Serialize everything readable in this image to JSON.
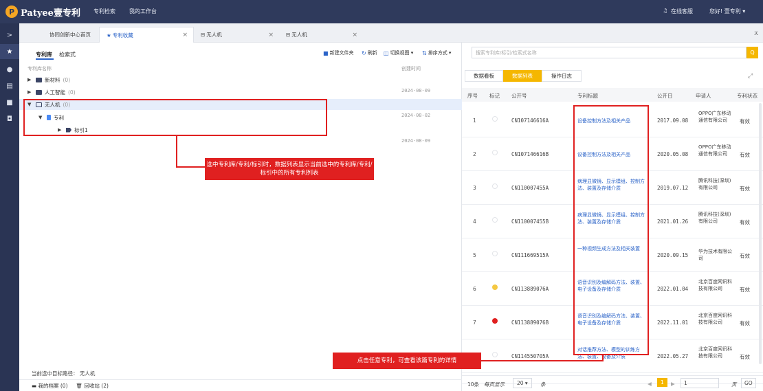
{
  "topbar": {
    "logo_mark": "P",
    "logo_text": "Patyee壹专利",
    "nav": [
      "专利检索",
      "我的工作台"
    ],
    "service": "在线客服",
    "greeting": "您好! 壹专利 ▾",
    "collapse": "ㅈ"
  },
  "rail": {
    "toggle": ">",
    "icons": [
      "star-icon",
      "folder-icon",
      "monitor-icon",
      "book-icon",
      "user-icon"
    ]
  },
  "tabs": [
    {
      "label": "协同创新中心首页",
      "active": false,
      "closable": false
    },
    {
      "label": "专利收藏",
      "active": true,
      "closable": true,
      "prefix": "★"
    },
    {
      "label": "无人机",
      "active": false,
      "closable": true,
      "prefix": "⊟"
    },
    {
      "label": "无人机",
      "active": false,
      "closable": true,
      "prefix": "⊟"
    }
  ],
  "left": {
    "subtabs": [
      "专利库",
      "检索式"
    ],
    "toolbar": [
      {
        "icon": "■",
        "label": "新建文件夹"
      },
      {
        "icon": "↻",
        "label": "刷新"
      },
      {
        "icon": "◫",
        "label": "切换视图 ▾"
      },
      {
        "icon": "⇅",
        "label": "排序方式 ▾"
      }
    ],
    "header": {
      "name": "专利库名称",
      "created": "创建时间"
    },
    "tree": [
      {
        "name": "新材料",
        "count": "(0)",
        "date": "2024-08-09",
        "level": 0,
        "expanded": false
      },
      {
        "name": "人工智能",
        "count": "(0)",
        "date": "2024-08-09",
        "level": 0,
        "expanded": false
      },
      {
        "name": "无人机",
        "count": "(0)",
        "date": "2024-08-02",
        "level": 0,
        "expanded": true
      },
      {
        "name": "专利",
        "count": "",
        "date": "",
        "level": 1,
        "expanded": true
      },
      {
        "name": "标引1",
        "count": "",
        "date": "2024-08-09",
        "level": 2,
        "expanded": false
      }
    ],
    "path_label": "当前选中目标路径：",
    "path_value": "无人机",
    "footer": [
      {
        "icon": "▬",
        "label": "我的档案 (0)"
      },
      {
        "icon": "🗑",
        "label": "回收站 (2)"
      }
    ]
  },
  "right": {
    "search_placeholder": "搜索专利库/标引/检索式名称",
    "search_icon": "Q",
    "view_tabs": [
      "数据看板",
      "数据列表",
      "操作日志"
    ],
    "active_view": 1,
    "expand_icon": "⤢",
    "columns": [
      "序号",
      "标记",
      "公开号",
      "专利标题",
      "公开日",
      "申请人",
      "专利状态"
    ],
    "rows": [
      {
        "no": "1",
        "mark": "",
        "pub": "CN107146616A",
        "title": "设备控制方法及相关产品",
        "date": "2017.09.08",
        "applicant": "OPPO广东移动通信有限公司",
        "status": "有效"
      },
      {
        "no": "2",
        "mark": "",
        "pub": "CN107146616B",
        "title": "设备控制方法及相关产品",
        "date": "2020.05.08",
        "applicant": "OPPO广东移动通信有限公司",
        "status": "有效"
      },
      {
        "no": "3",
        "mark": "",
        "pub": "CN110007455A",
        "title": "病理显微镜、显示模组、控制方法、装置及存储介质",
        "date": "2019.07.12",
        "applicant": "腾讯科技(深圳)有限公司",
        "status": "有效"
      },
      {
        "no": "4",
        "mark": "",
        "pub": "CN110007455B",
        "title": "病理显微镜、显示模组、控制方法、装置及存储介质",
        "date": "2021.01.26",
        "applicant": "腾讯科技(深圳)有限公司",
        "status": "有效"
      },
      {
        "no": "5",
        "mark": "",
        "pub": "CN111669515A",
        "title": "一种视频生成方法及相关装置",
        "date": "2020.09.15",
        "applicant": "华为技术有限公司",
        "status": "有效"
      },
      {
        "no": "6",
        "mark": "#f5c842",
        "pub": "CN113889076A",
        "title": "语音识别及编解码方法、装置、电子设备及存储介质",
        "date": "2022.01.04",
        "applicant": "北京百度网讯科技有限公司",
        "status": "有效"
      },
      {
        "no": "7",
        "mark": "#e02020",
        "pub": "CN113889076B",
        "title": "语音识别及编解码方法、装置、电子设备及存储介质",
        "date": "2022.11.01",
        "applicant": "北京百度网讯科技有限公司",
        "status": "有效"
      },
      {
        "no": "8",
        "mark": "",
        "pub": "CN114550705A",
        "title": "对话推荐方法、模型的训练方法、装置、设备及介质",
        "date": "2022.05.27",
        "applicant": "北京百度网讯科技有限公司",
        "status": "有效"
      },
      {
        "no": "",
        "mark": "",
        "pub": "",
        "title": "对话推荐方法、模型的训练",
        "date": "",
        "applicant": "北京百度网",
        "status": ""
      }
    ],
    "pager": {
      "total": "10条",
      "per_page_label": "每页显示",
      "per_page": "20 ▾",
      "unit": "条",
      "prev": "◀",
      "current": "1",
      "next": "▶",
      "goto_value": "1",
      "page_label": "页",
      "go": "GO"
    }
  },
  "annotations": {
    "callout_1": "选中专利库/专利/标引时，数据列表显示当前选中的专利库/专利/标引中的所有专利列表",
    "callout_2": "点击任意专利，可查看该篇专利的详情"
  }
}
